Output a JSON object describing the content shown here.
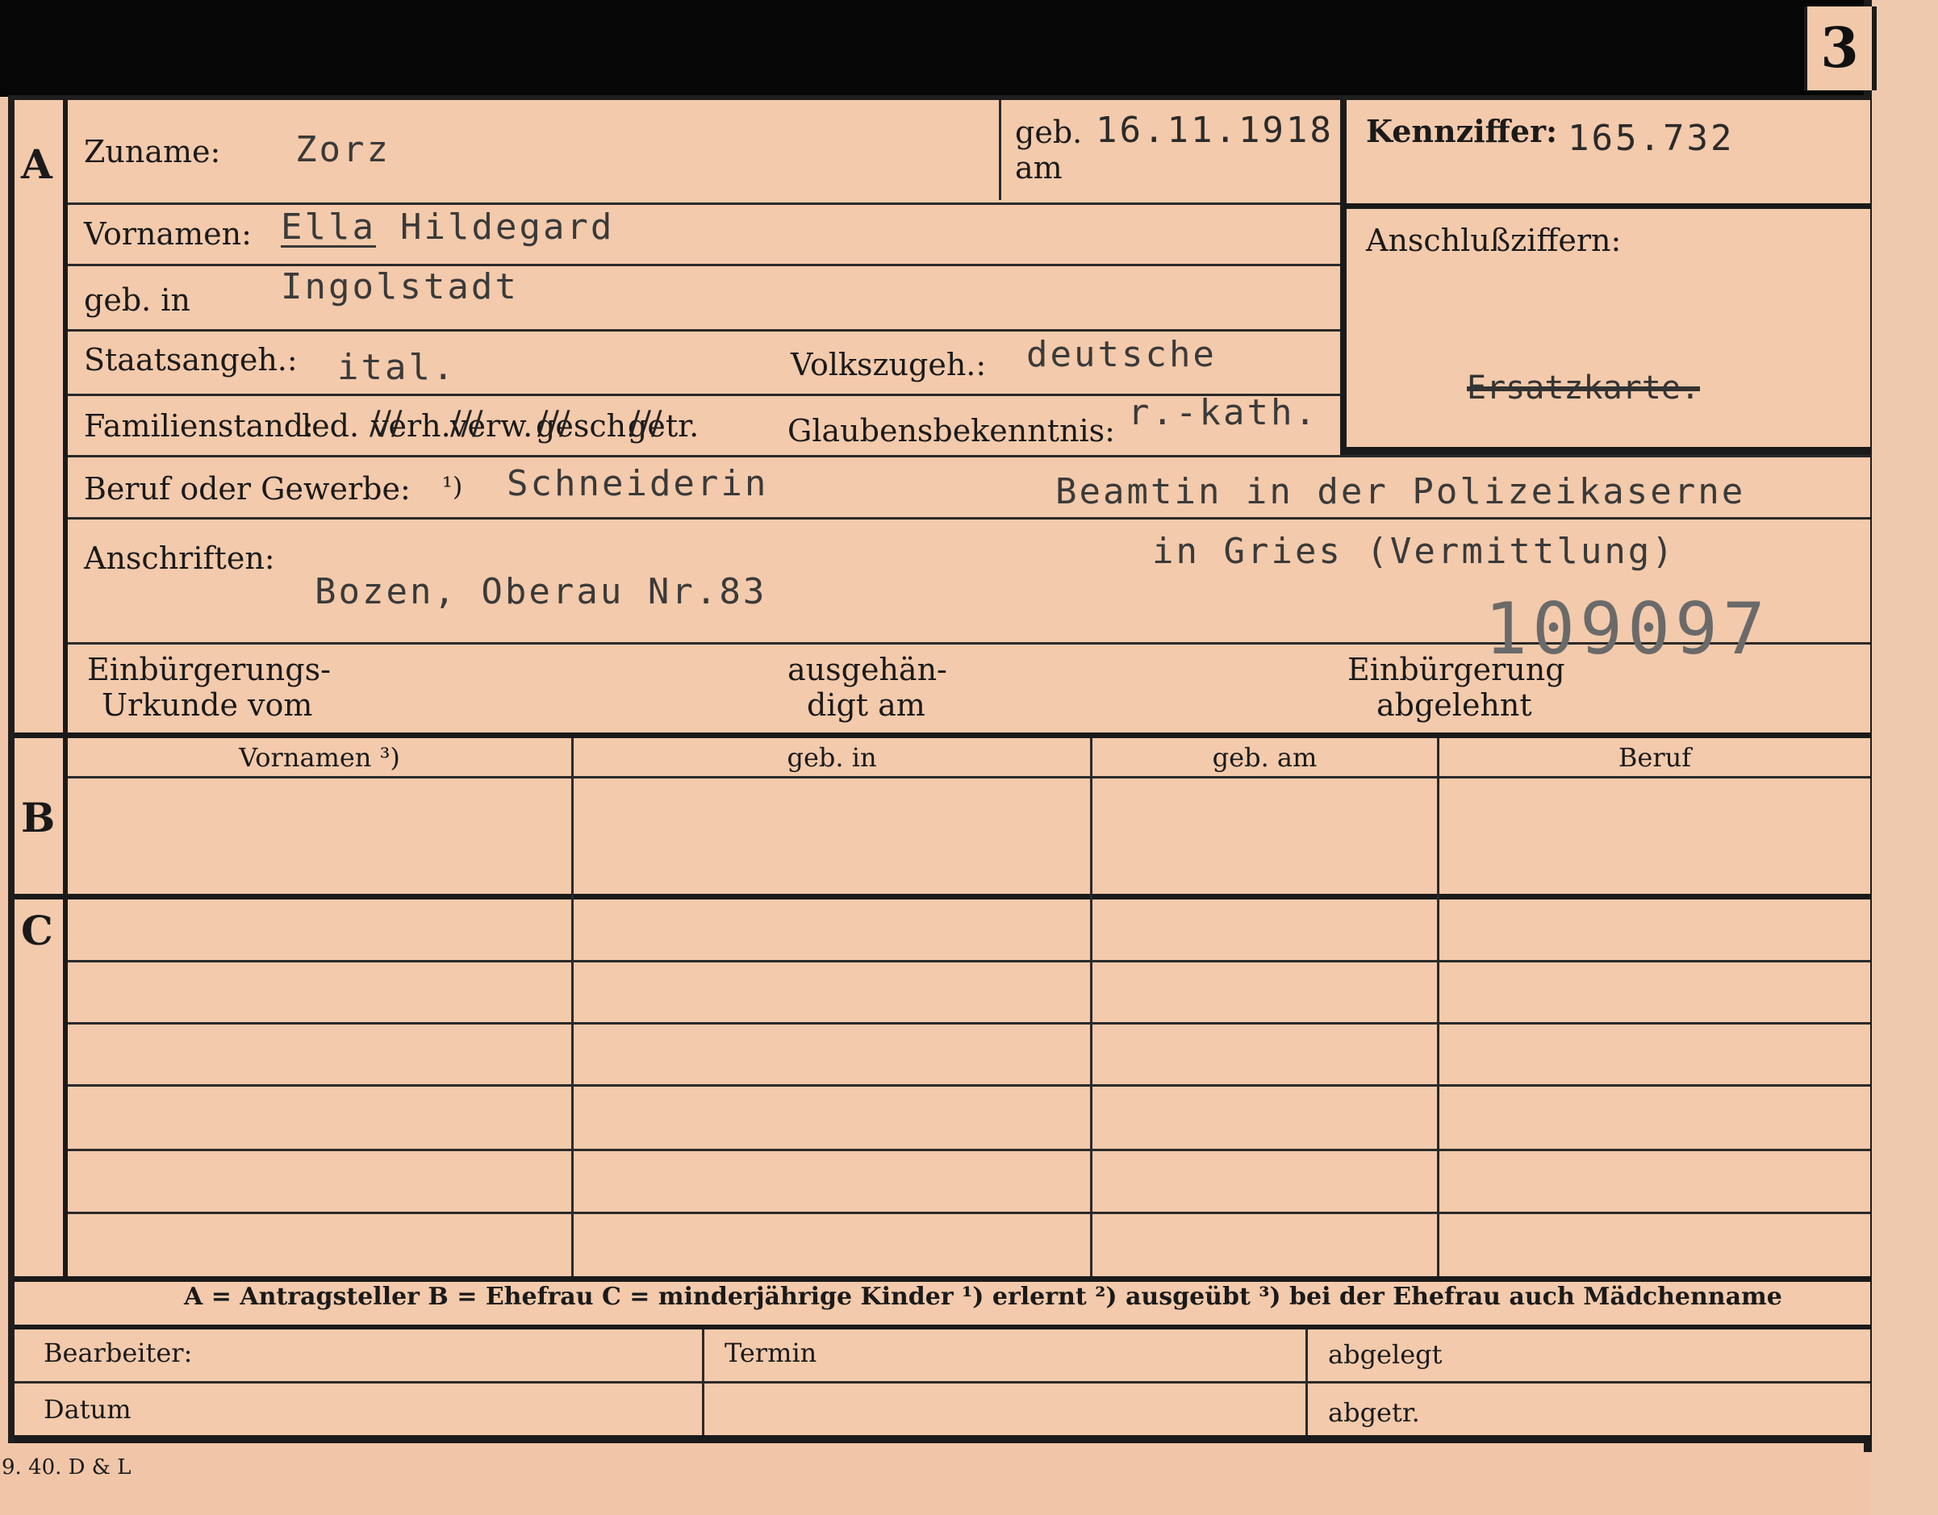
{
  "card_number": "3",
  "section_labels": {
    "a": "A",
    "b": "B",
    "c": "C"
  },
  "fields": {
    "zuname_label": "Zuname:",
    "zuname_value": "Zorz",
    "geb_am_label_1": "geb.",
    "geb_am_label_2": "am",
    "geb_am_value": "16.11.1918",
    "kennziffer_label": "Kennziffer:",
    "kennziffer_value": "165.732",
    "vornamen_label": "Vornamen:",
    "vornamen_value_1": "Ella",
    "vornamen_value_2": "Hildegard",
    "anschluss_label": "Anschlußziffern:",
    "ersatzkarte_value": "Ersatzkarte.",
    "geb_in_label": "geb. in",
    "geb_in_value": "Ingolstadt",
    "staatsangeh_label": "Staatsangeh.:",
    "staatsangeh_value": "ital.",
    "volkszugeh_label": "Volkszugeh.:",
    "volkszugeh_value": "deutsche",
    "familienstand_label": "Familienstand:",
    "familienstand_options": [
      "led.",
      "verh.",
      "verw.",
      "gesch.",
      "getr."
    ],
    "glaubens_label": "Glaubensbekenntnis:",
    "glaubens_value": "r.-kath.",
    "beruf_label": "Beruf oder Gewerbe:",
    "beruf_note": "¹)",
    "beruf_value_1": "Schneiderin",
    "beruf_value_2": "Beamtin in der Polizeikaserne",
    "anschriften_label": "Anschriften:",
    "anschriften_value": "Bozen, Oberau Nr.83",
    "anschriften_value_2": "in Gries (Vermittlung)",
    "stamp_number": "109097",
    "einbuergerung_urkunde_1": "Einbürgerungs-",
    "einbuergerung_urkunde_2": "Urkunde vom",
    "ausgehaendigt_1": "ausgehän-",
    "ausgehaendigt_2": "digt am",
    "einbuergerung_abgelehnt_1": "Einbürgerung",
    "einbuergerung_abgelehnt_2": "abgelehnt"
  },
  "table": {
    "headers": [
      "Vornamen ³)",
      "geb. in",
      "geb. am",
      "Beruf"
    ]
  },
  "legend": "A = Antragsteller   B = Ehefrau   C = minderjährige Kinder   ¹) erlernt   ²) ausgeübt   ³) bei der Ehefrau auch Mädchenname",
  "footer": {
    "bearbeiter": "Bearbeiter:",
    "datum": "Datum",
    "termin": "Termin",
    "abgelegt": "abgelegt",
    "abgetr": "abgetr."
  },
  "print_mark": "9. 40. D & L"
}
